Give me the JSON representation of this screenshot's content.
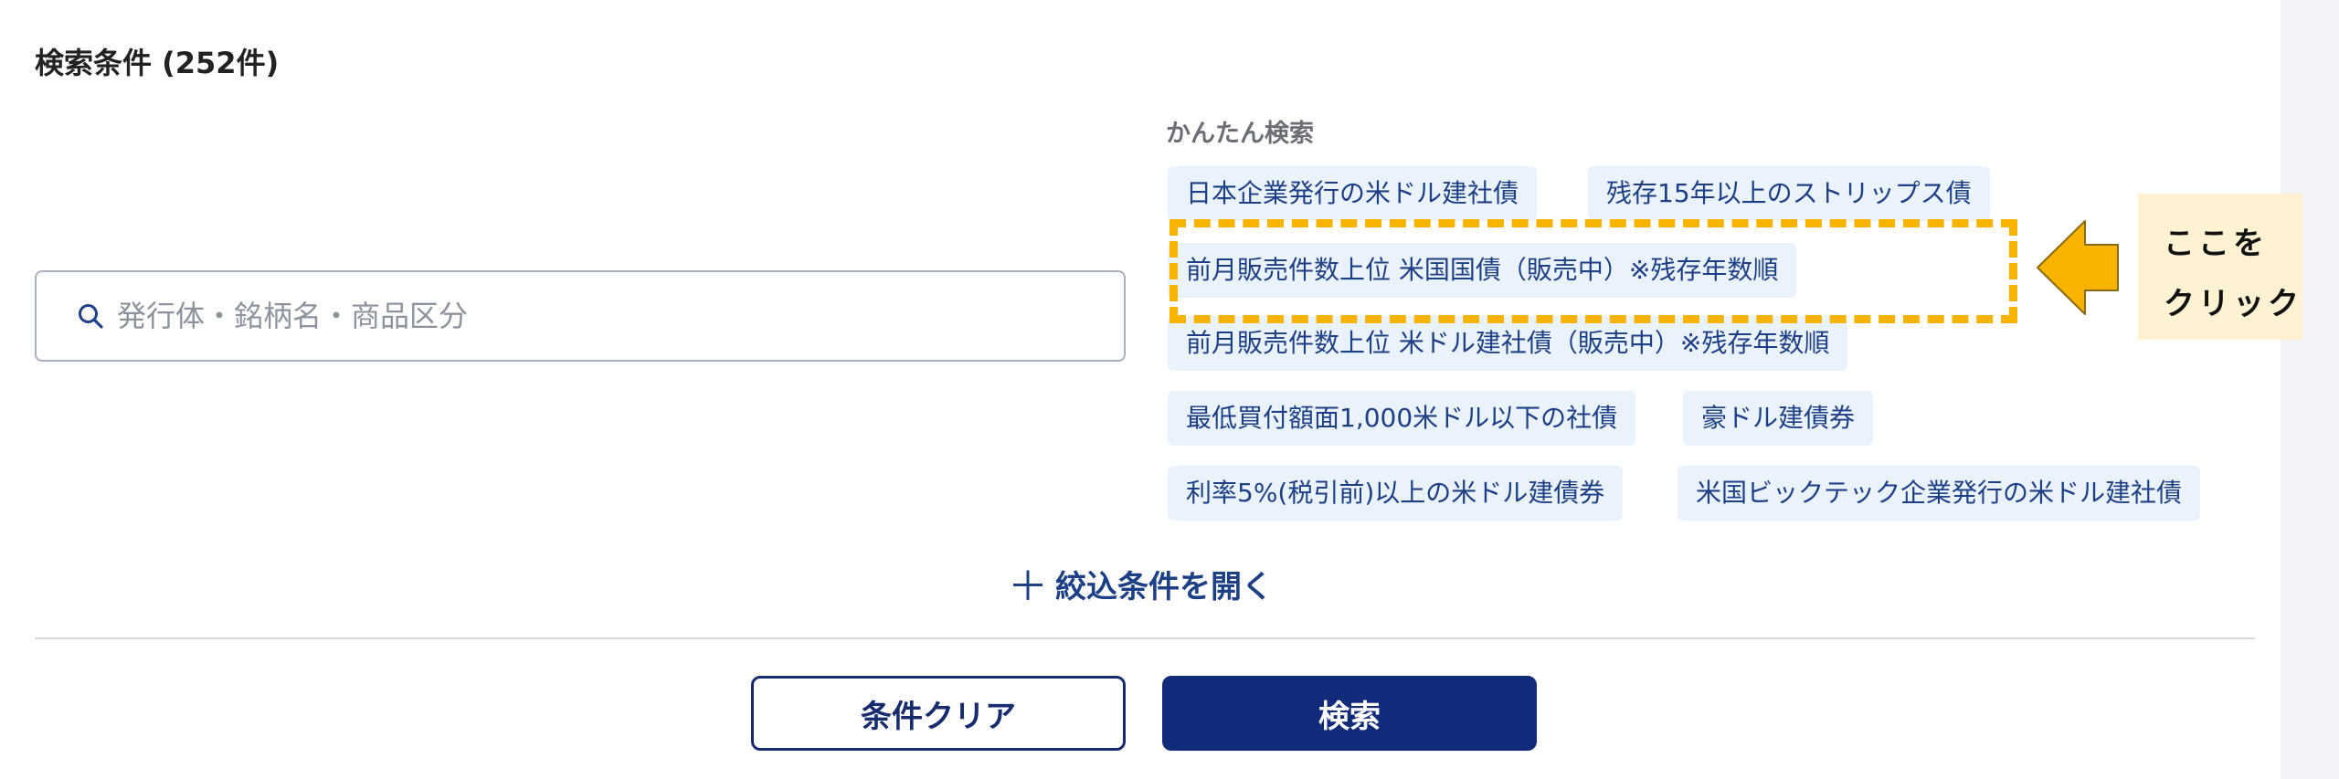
{
  "header": {
    "title": "検索条件 (252件)"
  },
  "search": {
    "placeholder": "発行体・銘柄名・商品区分",
    "value": ""
  },
  "quick_search": {
    "label": "かんたん検索",
    "chips": [
      "日本企業発行の米ドル建社債",
      "残存15年以上のストリップス債",
      "前月販売件数上位 米国国債（販売中）※残存年数順",
      "前月販売件数上位 米ドル建社債（販売中）※残存年数順",
      "最低買付額面1,000米ドル以下の社債",
      "豪ドル建債券",
      "利率5%(税引前)以上の米ドル建債券",
      "米国ビックテック企業発行の米ドル建社債"
    ]
  },
  "callout": {
    "line1": "ここを",
    "line2": "クリック"
  },
  "filters": {
    "open_label": "絞込条件を開く"
  },
  "actions": {
    "clear_label": "条件クリア",
    "search_label": "検索"
  },
  "colors": {
    "accent_navy": "#112b7a",
    "chip_bg": "#eaf2fb",
    "chip_text": "#1d3f86",
    "highlight": "#f6b400",
    "callout_bg": "#fdf2d1"
  },
  "icons": {
    "search": "magnifier-icon",
    "plus": "plus-icon",
    "arrow": "left-arrow-icon"
  }
}
